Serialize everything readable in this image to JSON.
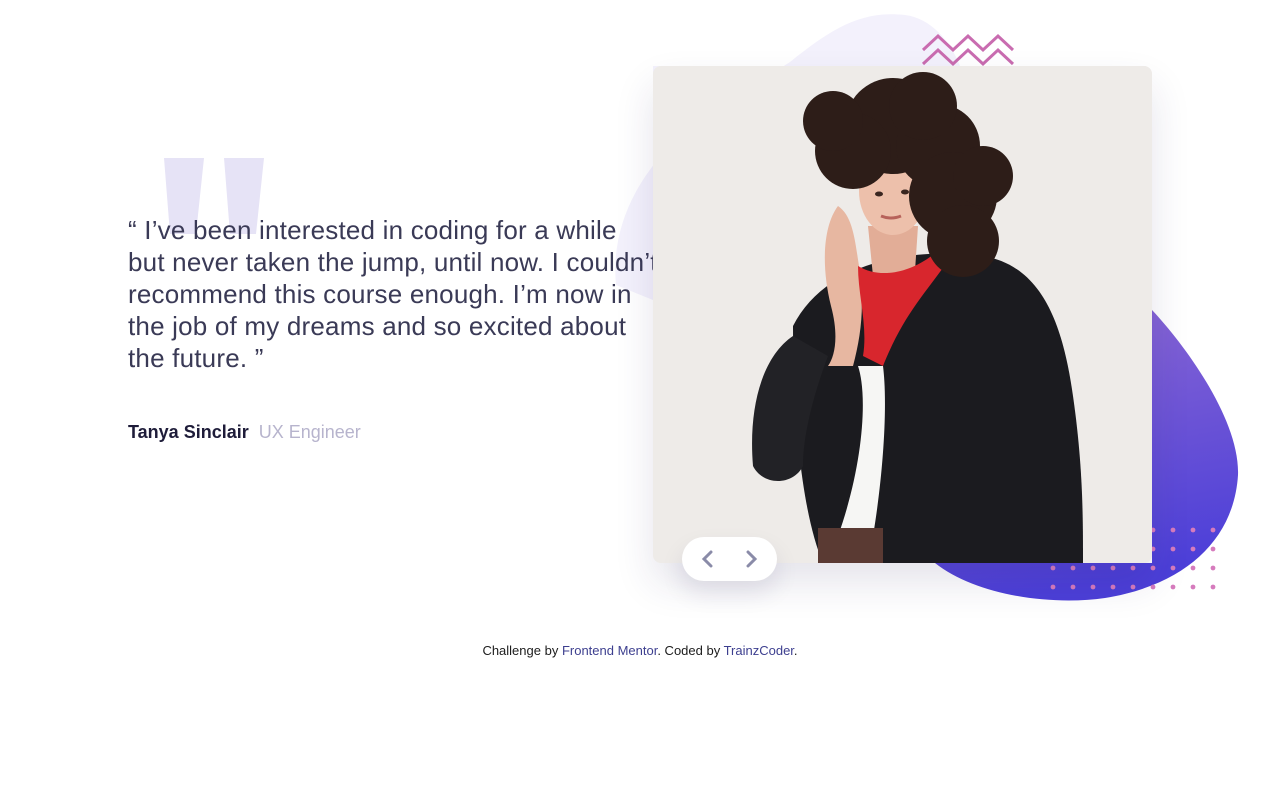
{
  "testimonial": {
    "quote": "“ I’ve been interested in coding for a while but never taken the jump, until now. I couldn’t recommend this course enough. I’m now in the job of my dreams and so excited about the future. ”",
    "author_name": "Tanya Sinclair",
    "author_role": "UX Engineer"
  },
  "photo": {
    "alt": "Tanya Sinclair"
  },
  "navigation": {
    "prev_icon": "chevron-left-icon",
    "next_icon": "chevron-right-icon"
  },
  "footer": {
    "prefix": "Challenge by ",
    "link1": "Frontend Mentor",
    "middle": ". Coded by ",
    "link2": "TrainzCoder",
    "suffix": "."
  },
  "colors": {
    "quote_text": "#3a3a56",
    "author_name": "#1e1c39",
    "author_role": "#b7b4cd",
    "blob_start": "#8d69d4",
    "blob_end": "#4c3fd8",
    "zigzag": "#c96cb0",
    "dots": "#d67bbd",
    "big_quote_mark": "#e6e3f6",
    "link": "#3d3f8f"
  }
}
